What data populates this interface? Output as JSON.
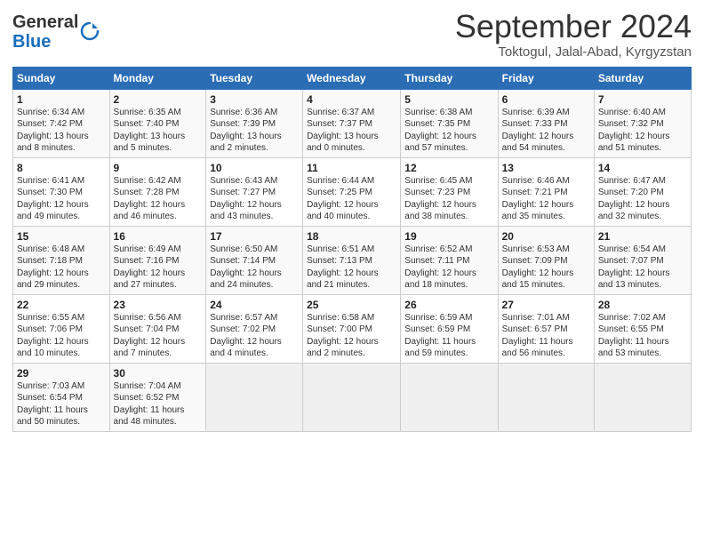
{
  "header": {
    "logo_general": "General",
    "logo_blue": "Blue",
    "month_title": "September 2024",
    "location": "Toktogul, Jalal-Abad, Kyrgyzstan"
  },
  "days_of_week": [
    "Sunday",
    "Monday",
    "Tuesday",
    "Wednesday",
    "Thursday",
    "Friday",
    "Saturday"
  ],
  "weeks": [
    [
      {
        "day": "1",
        "info": "Sunrise: 6:34 AM\nSunset: 7:42 PM\nDaylight: 13 hours\nand 8 minutes."
      },
      {
        "day": "2",
        "info": "Sunrise: 6:35 AM\nSunset: 7:40 PM\nDaylight: 13 hours\nand 5 minutes."
      },
      {
        "day": "3",
        "info": "Sunrise: 6:36 AM\nSunset: 7:39 PM\nDaylight: 13 hours\nand 2 minutes."
      },
      {
        "day": "4",
        "info": "Sunrise: 6:37 AM\nSunset: 7:37 PM\nDaylight: 13 hours\nand 0 minutes."
      },
      {
        "day": "5",
        "info": "Sunrise: 6:38 AM\nSunset: 7:35 PM\nDaylight: 12 hours\nand 57 minutes."
      },
      {
        "day": "6",
        "info": "Sunrise: 6:39 AM\nSunset: 7:33 PM\nDaylight: 12 hours\nand 54 minutes."
      },
      {
        "day": "7",
        "info": "Sunrise: 6:40 AM\nSunset: 7:32 PM\nDaylight: 12 hours\nand 51 minutes."
      }
    ],
    [
      {
        "day": "8",
        "info": "Sunrise: 6:41 AM\nSunset: 7:30 PM\nDaylight: 12 hours\nand 49 minutes."
      },
      {
        "day": "9",
        "info": "Sunrise: 6:42 AM\nSunset: 7:28 PM\nDaylight: 12 hours\nand 46 minutes."
      },
      {
        "day": "10",
        "info": "Sunrise: 6:43 AM\nSunset: 7:27 PM\nDaylight: 12 hours\nand 43 minutes."
      },
      {
        "day": "11",
        "info": "Sunrise: 6:44 AM\nSunset: 7:25 PM\nDaylight: 12 hours\nand 40 minutes."
      },
      {
        "day": "12",
        "info": "Sunrise: 6:45 AM\nSunset: 7:23 PM\nDaylight: 12 hours\nand 38 minutes."
      },
      {
        "day": "13",
        "info": "Sunrise: 6:46 AM\nSunset: 7:21 PM\nDaylight: 12 hours\nand 35 minutes."
      },
      {
        "day": "14",
        "info": "Sunrise: 6:47 AM\nSunset: 7:20 PM\nDaylight: 12 hours\nand 32 minutes."
      }
    ],
    [
      {
        "day": "15",
        "info": "Sunrise: 6:48 AM\nSunset: 7:18 PM\nDaylight: 12 hours\nand 29 minutes."
      },
      {
        "day": "16",
        "info": "Sunrise: 6:49 AM\nSunset: 7:16 PM\nDaylight: 12 hours\nand 27 minutes."
      },
      {
        "day": "17",
        "info": "Sunrise: 6:50 AM\nSunset: 7:14 PM\nDaylight: 12 hours\nand 24 minutes."
      },
      {
        "day": "18",
        "info": "Sunrise: 6:51 AM\nSunset: 7:13 PM\nDaylight: 12 hours\nand 21 minutes."
      },
      {
        "day": "19",
        "info": "Sunrise: 6:52 AM\nSunset: 7:11 PM\nDaylight: 12 hours\nand 18 minutes."
      },
      {
        "day": "20",
        "info": "Sunrise: 6:53 AM\nSunset: 7:09 PM\nDaylight: 12 hours\nand 15 minutes."
      },
      {
        "day": "21",
        "info": "Sunrise: 6:54 AM\nSunset: 7:07 PM\nDaylight: 12 hours\nand 13 minutes."
      }
    ],
    [
      {
        "day": "22",
        "info": "Sunrise: 6:55 AM\nSunset: 7:06 PM\nDaylight: 12 hours\nand 10 minutes."
      },
      {
        "day": "23",
        "info": "Sunrise: 6:56 AM\nSunset: 7:04 PM\nDaylight: 12 hours\nand 7 minutes."
      },
      {
        "day": "24",
        "info": "Sunrise: 6:57 AM\nSunset: 7:02 PM\nDaylight: 12 hours\nand 4 minutes."
      },
      {
        "day": "25",
        "info": "Sunrise: 6:58 AM\nSunset: 7:00 PM\nDaylight: 12 hours\nand 2 minutes."
      },
      {
        "day": "26",
        "info": "Sunrise: 6:59 AM\nSunset: 6:59 PM\nDaylight: 11 hours\nand 59 minutes."
      },
      {
        "day": "27",
        "info": "Sunrise: 7:01 AM\nSunset: 6:57 PM\nDaylight: 11 hours\nand 56 minutes."
      },
      {
        "day": "28",
        "info": "Sunrise: 7:02 AM\nSunset: 6:55 PM\nDaylight: 11 hours\nand 53 minutes."
      }
    ],
    [
      {
        "day": "29",
        "info": "Sunrise: 7:03 AM\nSunset: 6:54 PM\nDaylight: 11 hours\nand 50 minutes."
      },
      {
        "day": "30",
        "info": "Sunrise: 7:04 AM\nSunset: 6:52 PM\nDaylight: 11 hours\nand 48 minutes."
      },
      {
        "day": "",
        "info": ""
      },
      {
        "day": "",
        "info": ""
      },
      {
        "day": "",
        "info": ""
      },
      {
        "day": "",
        "info": ""
      },
      {
        "day": "",
        "info": ""
      }
    ]
  ]
}
